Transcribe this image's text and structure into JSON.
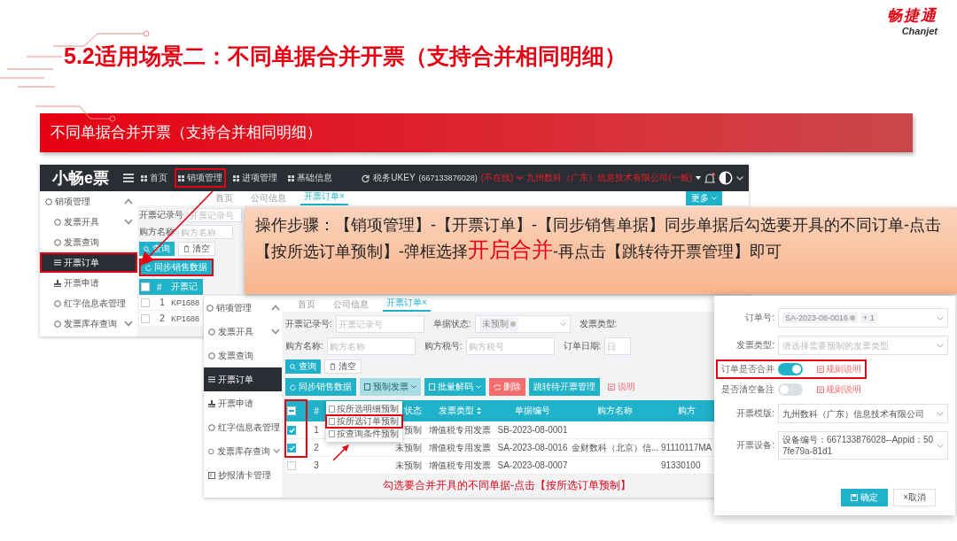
{
  "slide": {
    "title": "5.2适用场景二：不同单据合并开票（支持合并相同明细）",
    "brand_name": "畅捷通",
    "brand_latin": "Chanjet",
    "banner": "不同单据合并开票（支持合并相同明细）"
  },
  "screen_a": {
    "logo": "小畅e票",
    "nav": [
      {
        "label": "首页",
        "highlighted": false
      },
      {
        "label": "销项管理",
        "highlighted": true
      },
      {
        "label": "进项管理",
        "highlighted": false
      },
      {
        "label": "基础信息",
        "highlighted": false
      }
    ],
    "ukey_label": "税务UKEY",
    "ukey_code": "(667133876028)",
    "ukey_status": "(不在线)",
    "company": "九州数科（广东）信息技术有限公司(一般)",
    "sidebar": [
      {
        "label": "销项管理",
        "kind": "group",
        "expandable": true,
        "expanded": true,
        "selected": false,
        "highlighted": false
      },
      {
        "label": "发票开具",
        "kind": "item",
        "expandable": true,
        "expanded": false,
        "selected": false,
        "highlighted": false
      },
      {
        "label": "发票查询",
        "kind": "item",
        "expandable": false,
        "selected": false,
        "highlighted": false
      },
      {
        "label": "开票订单",
        "kind": "list",
        "expandable": false,
        "selected": true,
        "highlighted": true
      },
      {
        "label": "开票申请",
        "kind": "stamp",
        "expandable": false,
        "selected": false,
        "highlighted": false
      },
      {
        "label": "红字信息表管理",
        "kind": "item",
        "expandable": false,
        "selected": false,
        "highlighted": false
      },
      {
        "label": "发票库存查询",
        "kind": "item",
        "expandable": true,
        "expanded": false,
        "selected": false,
        "highlighted": false
      }
    ],
    "tabs": [
      {
        "label": "首页",
        "selected": false
      },
      {
        "label": "公司信息",
        "selected": false
      },
      {
        "label": "开票订单",
        "close": "×",
        "selected": true
      }
    ],
    "more": "更多",
    "form": [
      {
        "label": "开票记录号",
        "placeholder": "开票记录号"
      },
      {
        "label": "购方名称",
        "placeholder": "购方名称"
      }
    ],
    "buttons": [
      {
        "label": "查询",
        "kind": "primary"
      },
      {
        "label": "清空",
        "kind": "default"
      }
    ],
    "sync": {
      "label": "同步销售数据",
      "highlighted": true
    },
    "table": {
      "all_checked": false,
      "columns": [
        "#",
        "开票记"
      ],
      "rows": [
        {
          "index": "1",
          "number": "KP1688",
          "checked": false
        },
        {
          "index": "2",
          "number": "KP1688",
          "checked": false
        }
      ]
    }
  },
  "callout": "操作步骤：【销项管理】-【开票订单】-【同步销售单据】同步单据后勾选要开具的不同订单-点击【按所选订单预制】-弹框选择**开启合并**-再点击【跳转待开票管理】即可",
  "screen_b": {
    "sidebar": [
      {
        "label": "销项管理",
        "kind": "group",
        "expandable": true,
        "expanded": true,
        "selected": false,
        "highlighted": false
      },
      {
        "label": "发票开具",
        "kind": "item",
        "expandable": true,
        "expanded": false,
        "selected": false,
        "highlighted": false
      },
      {
        "label": "发票查询",
        "kind": "item",
        "expandable": false,
        "selected": false,
        "highlighted": false
      },
      {
        "label": "开票订单",
        "kind": "list",
        "expandable": false,
        "selected": true,
        "highlighted": false
      },
      {
        "label": "开票申请",
        "kind": "stamp",
        "expandable": false,
        "selected": false,
        "highlighted": false
      },
      {
        "label": "红字信息表管理",
        "kind": "item",
        "expandable": false,
        "selected": false,
        "highlighted": false
      },
      {
        "label": "发票库存查询",
        "kind": "item",
        "expandable": true,
        "expanded": false,
        "selected": false,
        "highlighted": false
      },
      {
        "label": "抄报清卡管理",
        "kind": "card",
        "expandable": false,
        "selected": false,
        "highlighted": false
      }
    ],
    "tabs": [
      {
        "label": "首页",
        "selected": false
      },
      {
        "label": "公司信息",
        "selected": false
      },
      {
        "label": "开票订单",
        "close": "×",
        "selected": true
      }
    ],
    "form": [
      [
        {
          "label": "开票记录号:",
          "kind": "input",
          "placeholder": "开票记录号"
        },
        {
          "label": "单据状态:",
          "kind": "tag-select",
          "tag": "未预制"
        },
        {
          "label": "发票类型:",
          "kind": "label"
        }
      ],
      [
        {
          "label": "购方名称:",
          "kind": "input",
          "placeholder": "购方名称"
        },
        {
          "label": "购方税号:",
          "kind": "input",
          "placeholder": "购方税号"
        },
        {
          "label": "订单日期:",
          "kind": "input",
          "placeholder": "日"
        }
      ]
    ],
    "query_buttons": [
      {
        "label": "查询",
        "kind": "primary"
      },
      {
        "label": "清空",
        "kind": "default"
      }
    ],
    "actions": [
      {
        "label": "同步销售数据",
        "kind": "primary"
      },
      {
        "label": "预制发票",
        "kind": "dropdown",
        "open": true
      },
      {
        "label": "批量解码",
        "kind": "dropdown",
        "open": false
      },
      {
        "label": "删除",
        "kind": "danger"
      },
      {
        "label": "跳转待开票管理",
        "kind": "primary"
      },
      {
        "label": "说明",
        "kind": "link"
      }
    ],
    "menu": [
      {
        "label": "按所选明细预制",
        "highlighted": false
      },
      {
        "label": "按所选订单预制",
        "highlighted": true
      },
      {
        "label": "按查询条件预制",
        "highlighted": false
      }
    ],
    "table": {
      "partly_checked": true,
      "highlight_checkbox_column": true,
      "headers": {
        "index": "#",
        "status": "状态",
        "type": "发票类型",
        "number": "单据编号",
        "buyer": "购方名称",
        "tax_id": "购方"
      },
      "rows": [
        {
          "index": "1",
          "checked": true,
          "status": "预制",
          "type": "增值税专用发票",
          "number": "SB-2023-08-0001"
        },
        {
          "index": "2",
          "checked": true,
          "status": "未预制",
          "type": "增值税专用发票",
          "number": "SA-2023-08-0016",
          "buyer": "金财数科（北京）信...",
          "tax_id": "91110117MA"
        },
        {
          "index": "3",
          "checked": false,
          "status": "未预制",
          "type": "增值税专用发票",
          "number": "SA-2023-08-0007",
          "tax_id": "91330100"
        }
      ]
    },
    "annotation": "勾选要合并开具的不同单据-点击【按所选订单预制】"
  },
  "dialog": {
    "fields": [
      {
        "kind": "tags",
        "label": "订单号:",
        "tags": [
          "SA-2023-08-0016",
          "+ 1"
        ]
      },
      {
        "kind": "select",
        "label": "发票类型:",
        "placeholder": "请选择需要预制的发票类型"
      },
      {
        "kind": "switch",
        "label": "订单是否合并",
        "on": true,
        "link": "规则说明",
        "highlighted": true
      },
      {
        "kind": "switch",
        "label": "是否清空备注",
        "on": false,
        "link": "规则说明",
        "highlighted": false
      },
      {
        "kind": "select",
        "label": "开票模版:",
        "value": "九州数科（广东）信息技术有限公司"
      },
      {
        "kind": "select",
        "label": "开票设备:",
        "value": "设备编号：667133876028--Appid：507fe79a-81d1"
      }
    ],
    "buttons": [
      {
        "label": "确定",
        "kind": "primary"
      },
      {
        "label": "×取消",
        "kind": "default"
      }
    ]
  }
}
